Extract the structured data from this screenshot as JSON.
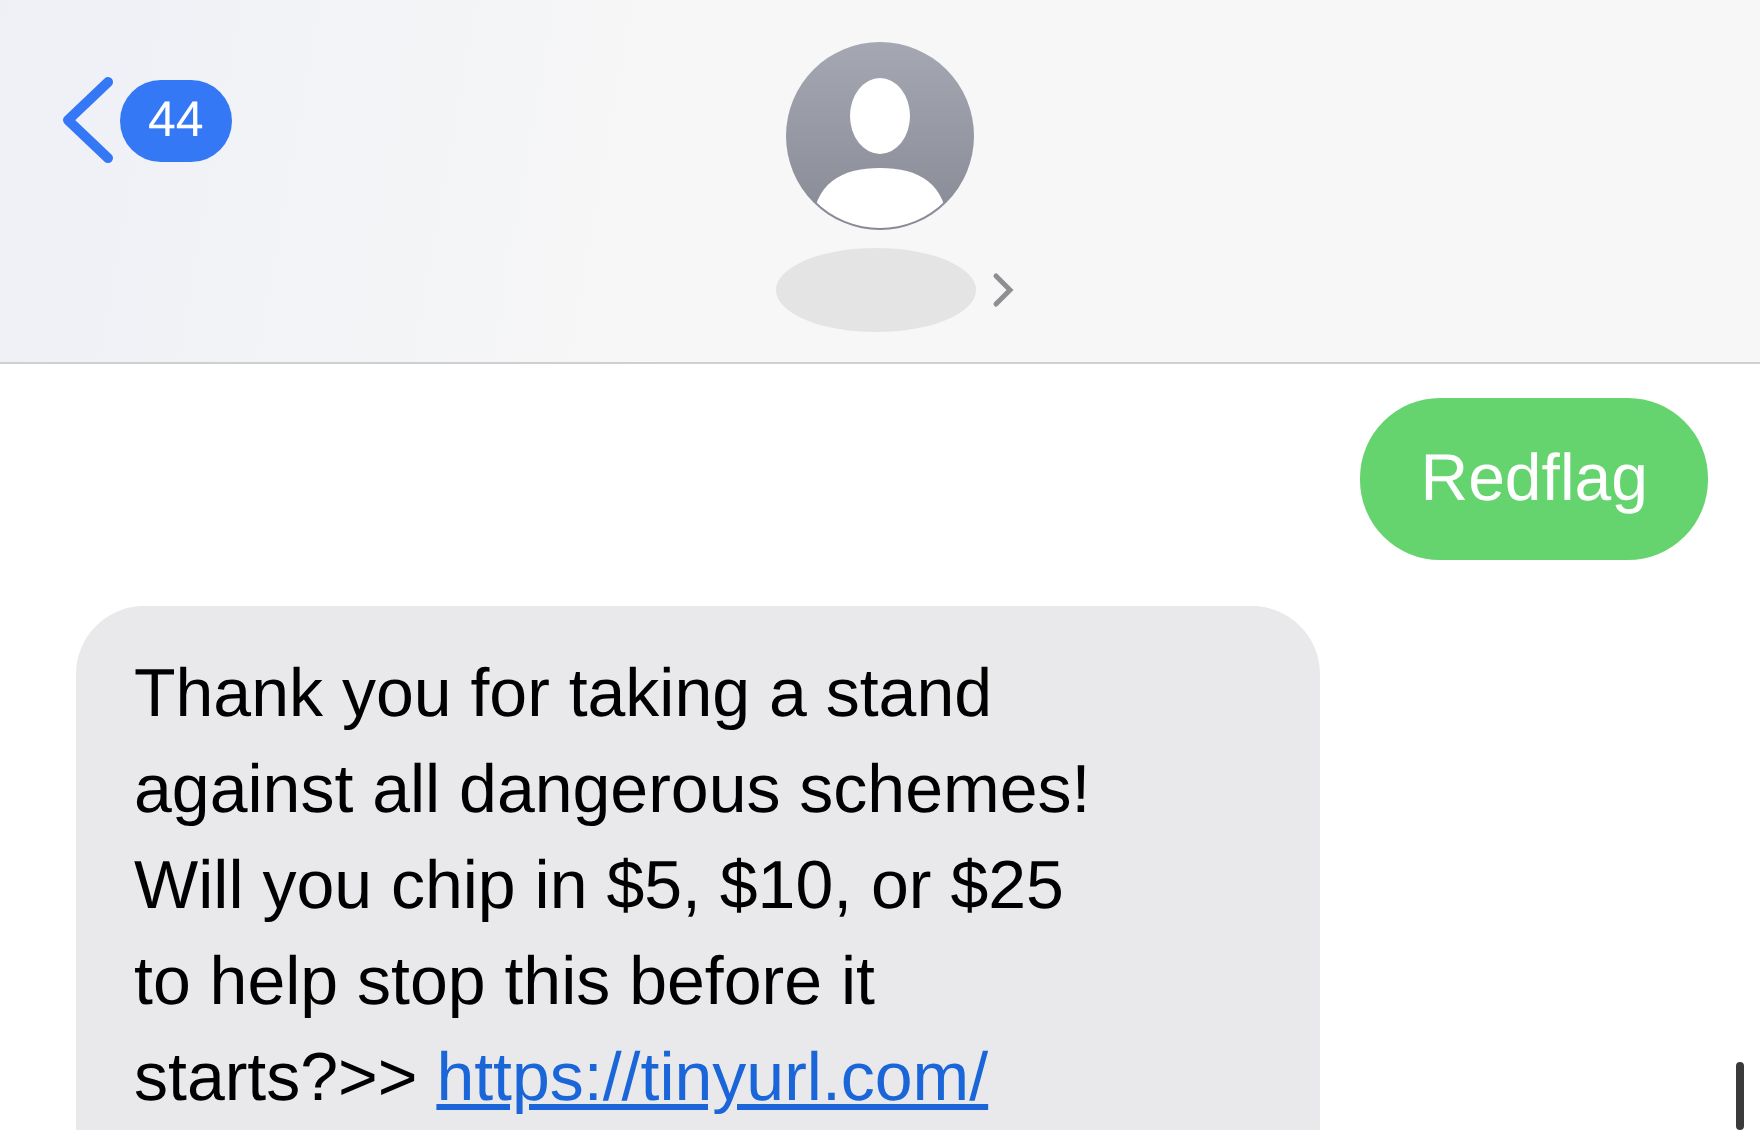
{
  "header": {
    "back_badge": "44"
  },
  "messages": [
    {
      "kind": "sent",
      "text": "Redflag"
    },
    {
      "kind": "received",
      "lines": [
        "Thank you for taking a stand",
        "against all dangerous schemes!",
        "Will you chip in $5, $10, or $25",
        "to help stop this before it",
        "starts?>> "
      ],
      "link": "https://tinyurl.com/"
    }
  ]
}
